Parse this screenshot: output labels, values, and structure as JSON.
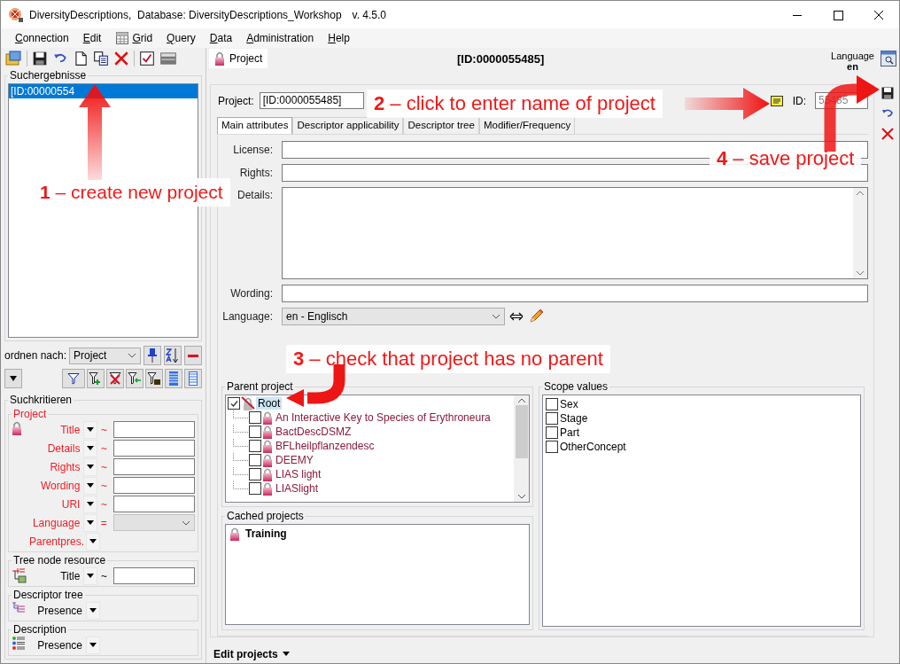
{
  "window": {
    "title": "DiversityDescriptions,  Database: DiversityDescriptions_Workshop",
    "version": "v. 4.5.0"
  },
  "menu": [
    {
      "label": "Connection",
      "kind": "text"
    },
    {
      "label": "Edit",
      "kind": "text"
    },
    {
      "label": "Grid",
      "kind": "icon"
    },
    {
      "label": "Query",
      "kind": "text"
    },
    {
      "label": "Data",
      "kind": "text"
    },
    {
      "label": "Administration",
      "kind": "text"
    },
    {
      "label": "Help",
      "kind": "text"
    }
  ],
  "search_results": {
    "title": "Suchergebnisse",
    "items": [
      {
        "label": "[ID:00000554",
        "selected": true
      }
    ]
  },
  "sort": {
    "label": "ordnen nach:",
    "value": "Project"
  },
  "query": {
    "title": "Suchkritieren",
    "groups": [
      {
        "title": "Project",
        "kind": "project",
        "fields": [
          {
            "label": "Title",
            "operator": "~",
            "kind": "text"
          },
          {
            "label": "Details",
            "operator": "~",
            "kind": "text"
          },
          {
            "label": "Rights",
            "operator": "~",
            "kind": "text"
          },
          {
            "label": "Wording",
            "operator": "~",
            "kind": "text"
          },
          {
            "label": "URI",
            "operator": "~",
            "kind": "text"
          },
          {
            "label": "Language",
            "operator": "=",
            "kind": "select"
          },
          {
            "label": "Parentpres.",
            "kind": "none"
          }
        ]
      },
      {
        "title": "Tree node resource",
        "kind": "resource",
        "fields": [
          {
            "label": "Title",
            "operator": "~",
            "kind": "text"
          }
        ]
      },
      {
        "title": "Descriptor tree",
        "kind": "descriptor_tree",
        "fields": [
          {
            "label": "Presence",
            "kind": "none"
          }
        ]
      },
      {
        "title": "Description",
        "kind": "description",
        "fields": [
          {
            "label": "Presence",
            "kind": "none"
          }
        ]
      }
    ]
  },
  "detail": {
    "tab": "Project",
    "heading": "[ID:0000055485]",
    "language_label": "Language",
    "language": "en"
  },
  "project": {
    "label": "Project:",
    "value": "[ID:0000055485]",
    "id_label": "ID:",
    "id_value": "55485"
  },
  "tabs": [
    {
      "label": "Main attributes",
      "selected": true
    },
    {
      "label": "Descriptor applicability",
      "selected": false
    },
    {
      "label": "Descriptor tree",
      "selected": false
    },
    {
      "label": "Modifier/Frequency",
      "selected": false
    }
  ],
  "fields": [
    {
      "label": "License:",
      "kind": "text"
    },
    {
      "label": "Rights:",
      "kind": "text"
    },
    {
      "label": "Details:",
      "kind": "textarea"
    },
    {
      "label": "Wording:",
      "kind": "text"
    },
    {
      "label": "Language:",
      "kind": "select",
      "value": "en - Englisch"
    }
  ],
  "parent_project": {
    "title": "Parent project",
    "root": {
      "label": "Root",
      "checked": true,
      "selected": true,
      "children": [
        {
          "label": "An Interactive Key to Species of Erythroneura",
          "checked": false
        },
        {
          "label": "BactDescDSMZ",
          "checked": false
        },
        {
          "label": "BFLheilpflanzendesc",
          "checked": false
        },
        {
          "label": "DEEMY",
          "checked": false
        },
        {
          "label": "LIAS light",
          "checked": false
        },
        {
          "label": "LIASlight",
          "checked": false
        }
      ]
    }
  },
  "cached_projects": {
    "title": "Cached projects",
    "items": [
      "Training"
    ]
  },
  "scope_values": {
    "title": "Scope values",
    "items": [
      {
        "label": "Sex",
        "checked": false
      },
      {
        "label": "Stage",
        "checked": false
      },
      {
        "label": "Part",
        "checked": false
      },
      {
        "label": "OtherConcept",
        "checked": false
      }
    ]
  },
  "status_bar": {
    "label": "Edit projects"
  },
  "annotations": [
    {
      "text": "**1** – create new project"
    },
    {
      "text": "**2** – click to enter name of project"
    },
    {
      "text": "**3** – check that project has no parent"
    },
    {
      "text": "**4** – save project"
    }
  ]
}
